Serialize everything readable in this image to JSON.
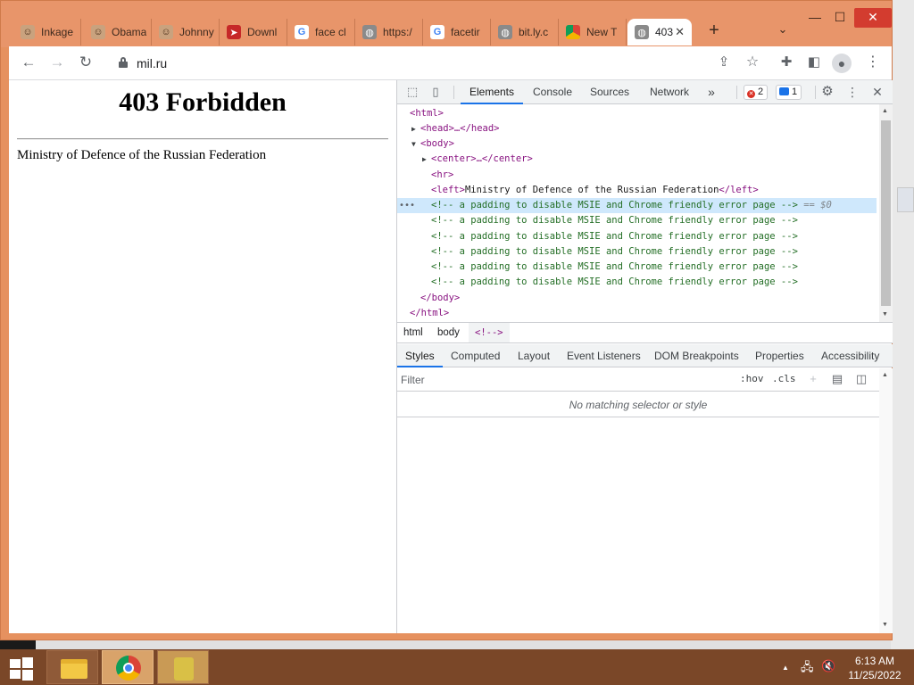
{
  "browser": {
    "tabs": [
      {
        "label": "Inkage",
        "icon": "face-photo-icon"
      },
      {
        "label": "Obama",
        "icon": "face-photo-icon"
      },
      {
        "label": "Johnny",
        "icon": "face-photo-icon"
      },
      {
        "label": "Downl",
        "icon": "pdf-icon"
      },
      {
        "label": "face cl",
        "icon": "google-icon"
      },
      {
        "label": "https:/",
        "icon": "globe-icon"
      },
      {
        "label": "facetir",
        "icon": "google-icon"
      },
      {
        "label": "bit.ly.c",
        "icon": "globe-icon"
      },
      {
        "label": "New T",
        "icon": "chrome-icon"
      },
      {
        "label": "403",
        "icon": "globe-icon",
        "active": true
      }
    ],
    "new_tab": "+",
    "url": "mil.ru"
  },
  "page": {
    "heading": "403 Forbidden",
    "body_text": "Ministry of Defence of the Russian Federation"
  },
  "devtools": {
    "tabs": [
      "Elements",
      "Console",
      "Sources",
      "Network"
    ],
    "active_tab": "Elements",
    "more_tabs": "»",
    "errors_count": "2",
    "messages_count": "1",
    "dom": {
      "html_open": "<html>",
      "head": "<head>…</head>",
      "body_open": "<body>",
      "center": "<center>…</center>",
      "hr": "<hr>",
      "left_open": "<left>",
      "left_text": "Ministry of Defence of the Russian Federation",
      "left_close": "</left>",
      "comment": "<!-- a padding to disable MSIE and Chrome friendly error page -->",
      "selected_marker": "== $0",
      "body_close": "</body>",
      "html_close": "</html>"
    },
    "breadcrumb": [
      "html",
      "body",
      "<!-->"
    ],
    "style_tabs": [
      "Styles",
      "Computed",
      "Layout",
      "Event Listeners",
      "DOM Breakpoints",
      "Properties",
      "Accessibility"
    ],
    "filter_placeholder": "Filter",
    "hov_label": ":hov",
    "cls_label": ".cls",
    "no_match": "No matching selector or style"
  },
  "taskbar": {
    "time": "6:13 AM",
    "date": "11/25/2022"
  },
  "colors": {
    "window_frame": "#e6915f",
    "taskbar": "#7a4728",
    "selection": "#cfe8fc",
    "tag": "#881280",
    "comment": "#236e25"
  }
}
